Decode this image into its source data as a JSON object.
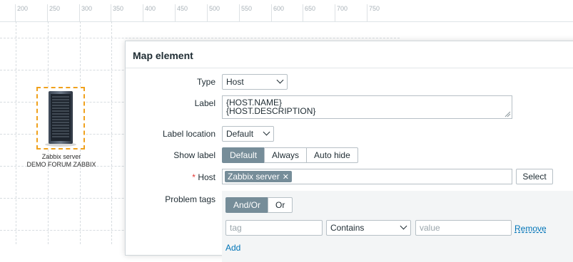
{
  "ruler": {
    "ticks": [
      "200",
      "250",
      "300",
      "350",
      "400",
      "450",
      "500",
      "550",
      "600",
      "650",
      "700",
      "750"
    ]
  },
  "map": {
    "host_label_line1": "Zabbix server",
    "host_label_line2": "DEMO FORUM ZABBIX",
    "icon": "server-rack-icon"
  },
  "modal": {
    "title": "Map element",
    "fields": {
      "type": {
        "label": "Type",
        "value": "Host"
      },
      "label": {
        "label": "Label",
        "line1": "{HOST.NAME}",
        "line2": "{HOST.DESCRIPTION}"
      },
      "label_location": {
        "label": "Label location",
        "value": "Default"
      },
      "show_label": {
        "label": "Show label",
        "options": [
          "Default",
          "Always",
          "Auto hide"
        ],
        "selected": "Default"
      },
      "host": {
        "label": "Host",
        "required_mark": "*",
        "chip": "Zabbix server",
        "select_button": "Select"
      },
      "problem_tags": {
        "label": "Problem tags",
        "operator_options": [
          "And/Or",
          "Or"
        ],
        "selected_operator": "And/Or",
        "tag_placeholder": "tag",
        "condition": "Contains",
        "value_placeholder": "value",
        "remove_link": "Remove",
        "add_link": "Add"
      }
    }
  },
  "colors": {
    "accent_gray": "#768d99",
    "selection_border": "#f0a11c",
    "link": "#0275b8",
    "required": "#e33734"
  }
}
